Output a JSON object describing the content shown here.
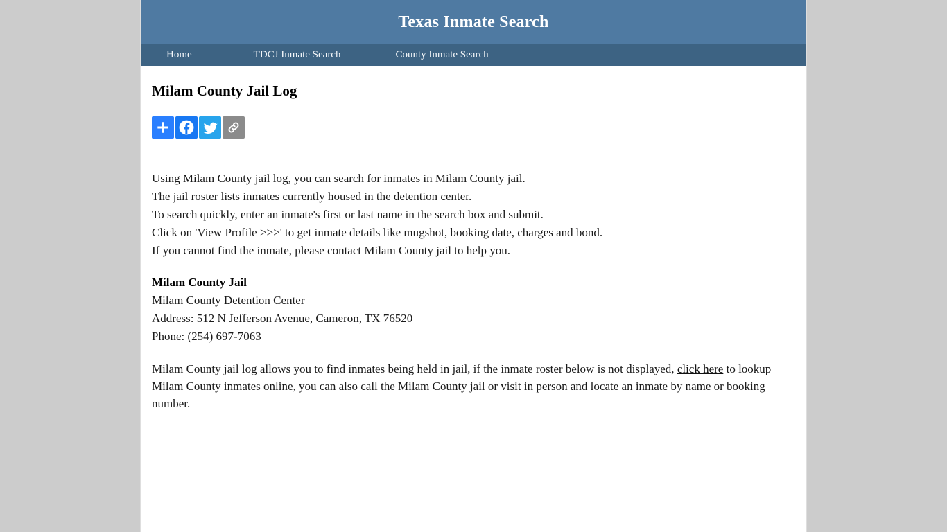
{
  "header": {
    "site_title": "Texas Inmate Search",
    "bg_color": "#4f7aa2"
  },
  "nav": {
    "bg_color": "#3d6383",
    "items": [
      {
        "label": "Home",
        "name": "home"
      },
      {
        "label": "TDCJ Inmate Search",
        "name": "tdcj-inmate-search"
      },
      {
        "label": "County Inmate Search",
        "name": "county-inmate-search"
      }
    ]
  },
  "main": {
    "page_title": "Milam County Jail Log",
    "share": {
      "buttons": [
        {
          "label": "Share",
          "icon": "plus-icon",
          "color": "#2a7fff"
        },
        {
          "label": "Facebook",
          "icon": "facebook-icon",
          "color": "#1878f3"
        },
        {
          "label": "Twitter",
          "icon": "twitter-icon",
          "color": "#27a4ec"
        },
        {
          "label": "Copy Link",
          "icon": "link-icon",
          "color": "#8b8b8b"
        }
      ]
    },
    "intro_lines": [
      "Using Milam County jail log, you can search for inmates in Milam County jail.",
      "The jail roster lists inmates currently housed in the detention center.",
      "To search quickly, enter an inmate's first or last name in the search box and submit.",
      "Click on 'View Profile >>>' to get inmate details like mugshot, booking date, charges and bond.",
      "If you cannot find the inmate, please contact Milam County jail to help you."
    ],
    "jail": {
      "name": "Milam County Jail",
      "facility": "Milam County Detention Center",
      "address": "Address: 512 N Jefferson Avenue, Cameron, TX 76520",
      "phone": "Phone: (254) 697-7063"
    },
    "closing": {
      "text_before_link": "Milam County jail log allows you to find inmates being held in jail, if the inmate roster below is not displayed, ",
      "link_text": "click here",
      "text_after_link": " to lookup Milam County inmates online, you can also call the Milam County jail or visit in person and locate an inmate by name or booking number."
    }
  }
}
